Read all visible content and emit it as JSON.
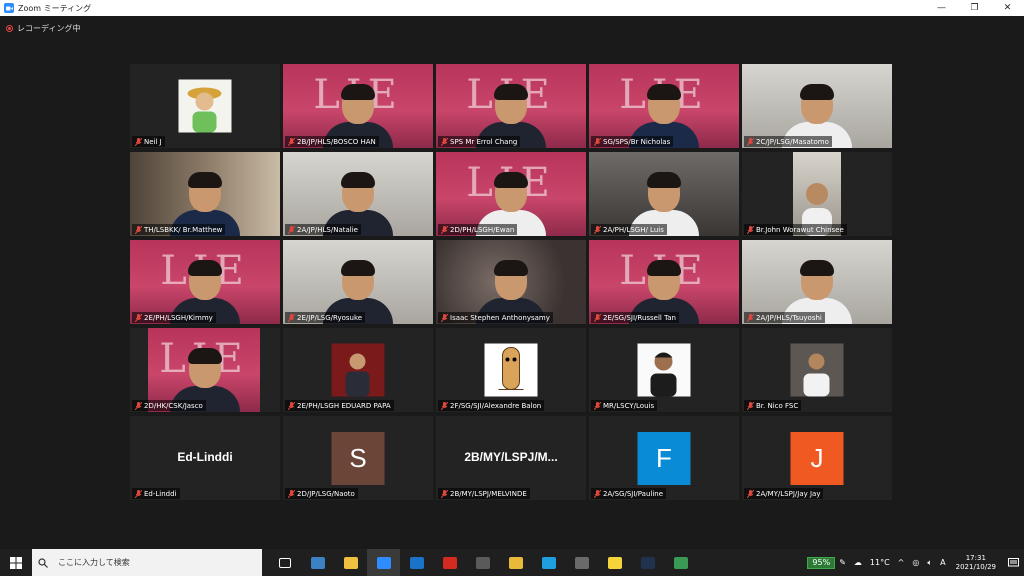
{
  "window": {
    "title": "Zoom ミーティング",
    "minimize": "—",
    "restore": "❐",
    "close": "✕"
  },
  "recording": {
    "label": "レコーディング中"
  },
  "participants": [
    {
      "name": "Neil J",
      "kind": "pic-cartoon"
    },
    {
      "name": "2B/JP/HLS/BOSCO HAN",
      "kind": "slide",
      "body": "dark"
    },
    {
      "name": "SPS Mr Errol Chang",
      "kind": "slide",
      "body": "dark"
    },
    {
      "name": "SG/SPS/Br Nicholas",
      "kind": "slide",
      "body": "navy"
    },
    {
      "name": "2C/JP/LSG/Masatomo",
      "kind": "white",
      "body": "light"
    },
    {
      "name": "TH/LSBKK/ Br.Matthew",
      "kind": "room",
      "body": "navy",
      "active": true
    },
    {
      "name": "2A/JP/HLS/Natalie",
      "kind": "white",
      "body": "dark"
    },
    {
      "name": "2D/PH/LSGH/Ewan",
      "kind": "slide",
      "body": "light"
    },
    {
      "name": "2A/PH/LSGH/ Luis",
      "kind": "grey",
      "body": "light"
    },
    {
      "name": "Br.John Worawut Chinsee",
      "kind": "pic-portrait"
    },
    {
      "name": "2E/PH/LSGH/Kimmy",
      "kind": "slide",
      "body": "dark"
    },
    {
      "name": "2E/JP/LSG/Ryosuke",
      "kind": "white",
      "body": "dark"
    },
    {
      "name": "Isaac Stephen Anthonysamy",
      "kind": "blur",
      "body": "dark"
    },
    {
      "name": "2E/SG/SJI/Russell Tan",
      "kind": "slide",
      "body": "dark"
    },
    {
      "name": "2A/JP/HLS/Tsuyoshi",
      "kind": "white",
      "body": "light"
    },
    {
      "name": "2D/HK/CSK/Jasco",
      "kind": "slide-small",
      "body": "dark"
    },
    {
      "name": "2E/PH/LSGH EDUARD PAPA",
      "kind": "pic-suit"
    },
    {
      "name": "2F/SG/SJI/Alexandre Balon",
      "kind": "pic-bread"
    },
    {
      "name": "MR/LSCY/Louis",
      "kind": "pic-young"
    },
    {
      "name": "Br. Nico FSC",
      "kind": "pic-chef"
    },
    {
      "name": "Ed-Linddi",
      "kind": "text",
      "display": "Ed-Linddi"
    },
    {
      "name": "2D/JP/LSG/Naoto",
      "kind": "letter",
      "letter": "S",
      "color": "#6b4638"
    },
    {
      "name": "2B/MY/LSPJ/MELVINDE",
      "kind": "text",
      "display": "2B/MY/LSPJ/M..."
    },
    {
      "name": "2A/SG/SJI/Pauline",
      "kind": "letter",
      "letter": "F",
      "color": "#0a8bd6"
    },
    {
      "name": "2A/MY/LSPJ/Jay Jay",
      "kind": "letter",
      "letter": "J",
      "color": "#f05a22"
    }
  ],
  "slide_letters": "LIE",
  "taskbar": {
    "search_placeholder": "ここに入力して検索",
    "apps": [
      {
        "name": "task-view",
        "color": "#1f1f1f"
      },
      {
        "name": "store",
        "color": "#3b82c4"
      },
      {
        "name": "explorer",
        "color": "#f0c040"
      },
      {
        "name": "zoom",
        "color": "#2d8cff",
        "active": true
      },
      {
        "name": "mail",
        "color": "#1a73c8"
      },
      {
        "name": "acrobat",
        "color": "#d42a20"
      },
      {
        "name": "calculator",
        "color": "#5a5a5a"
      },
      {
        "name": "chrome",
        "color": "#e9b93a"
      },
      {
        "name": "edge",
        "color": "#1f9ee0"
      },
      {
        "name": "camera",
        "color": "#6a6a6a"
      },
      {
        "name": "sticky-notes",
        "color": "#f5d33a"
      },
      {
        "name": "app-blue",
        "color": "#20324e"
      },
      {
        "name": "chrome-2",
        "color": "#3a9a55"
      }
    ],
    "battery": "95%",
    "temperature": "11°C",
    "ime": "A",
    "time": "17:31",
    "date": "2021/10/29"
  }
}
